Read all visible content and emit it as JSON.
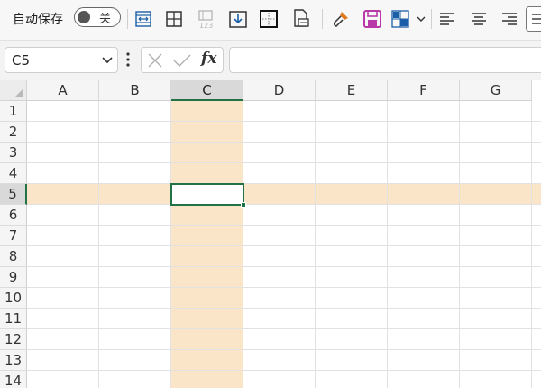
{
  "toolbar": {
    "autosave_label": "自动保存",
    "autosave_state": "关",
    "icons": [
      "wrap-text-icon",
      "borders-icon",
      "number-format-icon",
      "download-icon",
      "border-grid-icon",
      "print-preview-icon",
      "format-painter-icon",
      "save-icon",
      "fill-color-icon",
      "align-left-icon",
      "align-center-icon",
      "align-right-icon"
    ]
  },
  "formula_bar": {
    "name_box": "C5",
    "fx_label": "fx",
    "formula_value": ""
  },
  "grid": {
    "columns": [
      "A",
      "B",
      "C",
      "D",
      "E",
      "F",
      "G"
    ],
    "rows": [
      "1",
      "2",
      "3",
      "4",
      "5",
      "6",
      "7",
      "8",
      "9",
      "10",
      "11",
      "12",
      "13",
      "14"
    ],
    "active_column": "C",
    "active_row": "5"
  },
  "colors": {
    "accent": "#217346",
    "highlight": "#fbe5c8",
    "save_icon": "#b83aa8"
  }
}
